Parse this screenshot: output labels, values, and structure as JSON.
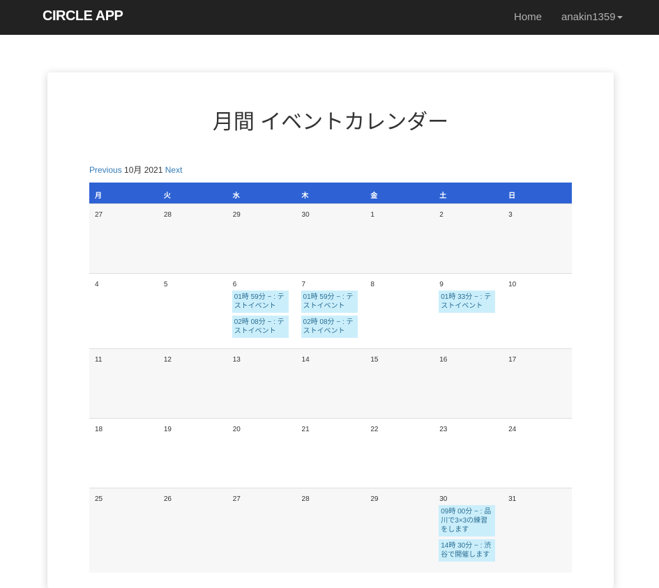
{
  "navbar": {
    "brand": "CIRCLE APP",
    "home": "Home",
    "user": "anakin1359"
  },
  "page": {
    "title": "月間 イベントカレンダー"
  },
  "month_nav": {
    "previous": "Previous",
    "current": "10月 2021",
    "next": "Next"
  },
  "weekdays": [
    "月",
    "火",
    "水",
    "木",
    "金",
    "土",
    "日"
  ],
  "weeks": [
    {
      "days": [
        {
          "day": "27",
          "events": []
        },
        {
          "day": "28",
          "events": []
        },
        {
          "day": "29",
          "events": []
        },
        {
          "day": "30",
          "events": []
        },
        {
          "day": "1",
          "events": []
        },
        {
          "day": "2",
          "events": []
        },
        {
          "day": "3",
          "events": []
        }
      ]
    },
    {
      "days": [
        {
          "day": "4",
          "events": []
        },
        {
          "day": "5",
          "events": []
        },
        {
          "day": "6",
          "events": [
            "01時 59分 ~ : テストイベント",
            "02時 08分 ~ : テストイベント"
          ]
        },
        {
          "day": "7",
          "events": [
            "01時 59分 ~ : テストイベント",
            "02時 08分 ~ : テストイベント"
          ]
        },
        {
          "day": "8",
          "events": []
        },
        {
          "day": "9",
          "events": [
            "01時 33分 ~ : テストイベント"
          ]
        },
        {
          "day": "10",
          "events": []
        }
      ]
    },
    {
      "days": [
        {
          "day": "11",
          "events": []
        },
        {
          "day": "12",
          "events": []
        },
        {
          "day": "13",
          "events": []
        },
        {
          "day": "14",
          "events": []
        },
        {
          "day": "15",
          "events": []
        },
        {
          "day": "16",
          "events": []
        },
        {
          "day": "17",
          "events": []
        }
      ]
    },
    {
      "days": [
        {
          "day": "18",
          "events": []
        },
        {
          "day": "19",
          "events": []
        },
        {
          "day": "20",
          "events": []
        },
        {
          "day": "21",
          "events": []
        },
        {
          "day": "22",
          "events": []
        },
        {
          "day": "23",
          "events": []
        },
        {
          "day": "24",
          "events": []
        }
      ]
    },
    {
      "days": [
        {
          "day": "25",
          "events": []
        },
        {
          "day": "26",
          "events": []
        },
        {
          "day": "27",
          "events": []
        },
        {
          "day": "28",
          "events": []
        },
        {
          "day": "29",
          "events": []
        },
        {
          "day": "30",
          "events": [
            "09時 00分 ~ : 品川で3×3の練習をします",
            "14時 30分 ~ : 渋谷で開催します"
          ]
        },
        {
          "day": "31",
          "events": []
        }
      ]
    }
  ],
  "colors": {
    "navbar": "#222222",
    "header": "#2e62d4",
    "event_bg": "#cbeefb",
    "link": "#337ab7"
  }
}
